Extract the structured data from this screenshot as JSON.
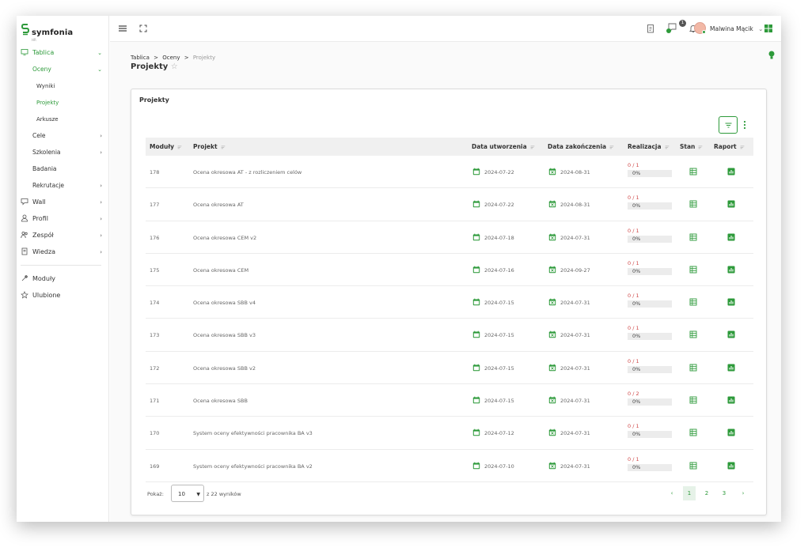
{
  "brand": {
    "name": "symfonia",
    "sub": "HR",
    "color": "#2d9a3a"
  },
  "sidebar": {
    "items": [
      {
        "label": "Tablica",
        "icon": "monitor-icon",
        "level": 0,
        "active": true,
        "chevron": "⌄"
      },
      {
        "label": "Oceny",
        "level": 1,
        "active": true,
        "chevron": "⌄"
      },
      {
        "label": "Wyniki",
        "level": 2,
        "active": false
      },
      {
        "label": "Projekty",
        "level": 2,
        "active": true
      },
      {
        "label": "Arkusze",
        "level": 2,
        "active": false
      },
      {
        "label": "Cele",
        "level": 1,
        "active": false,
        "chevron": "›"
      },
      {
        "label": "Szkolenia",
        "level": 1,
        "active": false,
        "chevron": "›"
      },
      {
        "label": "Badania",
        "level": 1,
        "active": false
      },
      {
        "label": "Rekrutacje",
        "level": 1,
        "active": false,
        "chevron": "›"
      },
      {
        "label": "Wall",
        "icon": "chat-icon",
        "level": 0,
        "active": false,
        "chevron": "›"
      },
      {
        "label": "Profil",
        "icon": "person-icon",
        "level": 0,
        "active": false,
        "chevron": "›"
      },
      {
        "label": "Zespół",
        "icon": "team-icon",
        "level": 0,
        "active": false,
        "chevron": "›"
      },
      {
        "label": "Wiedza",
        "icon": "book-icon",
        "level": 0,
        "active": false,
        "chevron": "›"
      }
    ],
    "bottom_items": [
      {
        "label": "Moduły",
        "icon": "wrench-icon"
      },
      {
        "label": "Ulubione",
        "icon": "star-icon"
      }
    ]
  },
  "topbar": {
    "user_name": "Malwina Mącik",
    "notification_count": "1",
    "user_caret": "⌄"
  },
  "breadcrumb": {
    "items": [
      "Tablica",
      "Oceny"
    ],
    "separator": ">",
    "current": "Projekty"
  },
  "page": {
    "title": "Projekty",
    "star": "☆"
  },
  "card": {
    "title": "Projekty"
  },
  "table": {
    "columns": [
      "Moduły",
      "Projekt",
      "Data utworzenia",
      "Data zakończenia",
      "Realizacja",
      "Stan",
      "Raport"
    ],
    "rows": [
      {
        "id": "178",
        "name": "Ocena okresowa AT - z rozliczeniem celów",
        "created": "2024-07-22",
        "ended": "2024-08-31",
        "frac": "0 / 1",
        "pct": "0%"
      },
      {
        "id": "177",
        "name": "Ocena okresowa AT",
        "created": "2024-07-22",
        "ended": "2024-08-31",
        "frac": "0 / 1",
        "pct": "0%"
      },
      {
        "id": "176",
        "name": "Ocena okresowa CEM v2",
        "created": "2024-07-18",
        "ended": "2024-07-31",
        "frac": "0 / 1",
        "pct": "0%"
      },
      {
        "id": "175",
        "name": "Ocena okresowa CEM",
        "created": "2024-07-16",
        "ended": "2024-09-27",
        "frac": "0 / 1",
        "pct": "0%"
      },
      {
        "id": "174",
        "name": "Ocena okresowa SBB v4",
        "created": "2024-07-15",
        "ended": "2024-07-31",
        "frac": "0 / 1",
        "pct": "0%"
      },
      {
        "id": "173",
        "name": "Ocena okresowa SBB v3",
        "created": "2024-07-15",
        "ended": "2024-07-31",
        "frac": "0 / 1",
        "pct": "0%"
      },
      {
        "id": "172",
        "name": "Ocena okresowa SBB v2",
        "created": "2024-07-15",
        "ended": "2024-07-31",
        "frac": "0 / 1",
        "pct": "0%"
      },
      {
        "id": "171",
        "name": "Ocena okresowa SBB",
        "created": "2024-07-15",
        "ended": "2024-07-31",
        "frac": "0 / 2",
        "pct": "0%"
      },
      {
        "id": "170",
        "name": "System oceny efektywności pracownika BA v3",
        "created": "2024-07-12",
        "ended": "2024-07-31",
        "frac": "0 / 1",
        "pct": "0%"
      },
      {
        "id": "169",
        "name": "System oceny efektywności pracownika BA v2",
        "created": "2024-07-10",
        "ended": "2024-07-31",
        "frac": "0 / 1",
        "pct": "0%"
      }
    ]
  },
  "footer": {
    "show_label": "Pokaż:",
    "page_size": "10",
    "results_text": "z 22 wyników",
    "prev": "‹",
    "next": "›",
    "pages": [
      "1",
      "2",
      "3"
    ],
    "current_page": "1"
  }
}
